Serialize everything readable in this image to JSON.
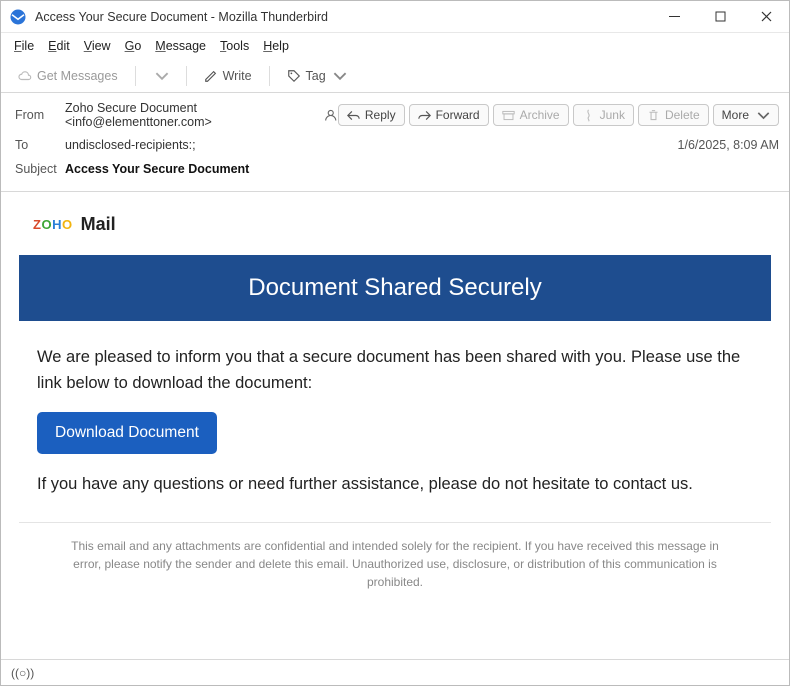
{
  "window": {
    "title": "Access Your Secure Document - Mozilla Thunderbird"
  },
  "menubar": {
    "file": "File",
    "edit": "Edit",
    "view": "View",
    "go": "Go",
    "message": "Message",
    "tools": "Tools",
    "help": "Help"
  },
  "toolbar": {
    "get_messages": "Get Messages",
    "write": "Write",
    "tag": "Tag"
  },
  "header": {
    "from_label": "From",
    "from_value": "Zoho Secure Document <info@elementtoner.com>",
    "to_label": "To",
    "to_value": "undisclosed-recipients:;",
    "subject_label": "Subject",
    "subject_value": "Access Your Secure Document",
    "date": "1/6/2025, 8:09 AM",
    "actions": {
      "reply": "Reply",
      "forward": "Forward",
      "archive": "Archive",
      "junk": "Junk",
      "delete": "Delete",
      "more": "More"
    }
  },
  "email": {
    "brand_mail": "Mail",
    "banner": "Document Shared Securely",
    "para1": "We are pleased to inform you that a secure document has been shared with you. Please use the link below to download the document:",
    "download": "Download Document",
    "para2": "If you have any questions or need further assistance, please do not hesitate to contact us.",
    "footer": "This email and any attachments are confidential and intended solely for the recipient. If you have received this message in error, please notify the sender and delete this email. Unauthorized use, disclosure, or distribution of this communication is prohibited."
  },
  "status": {
    "indicator": "((○))"
  }
}
